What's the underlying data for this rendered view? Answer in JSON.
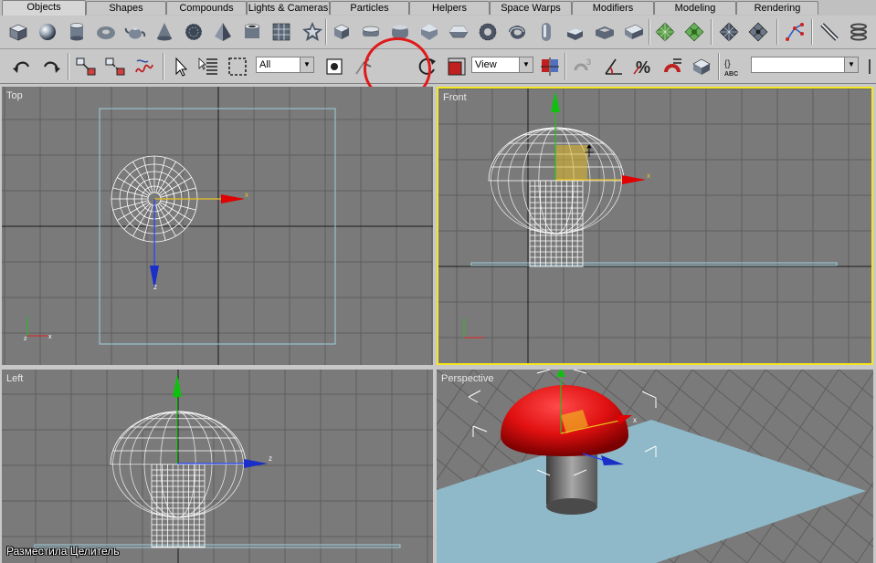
{
  "tabs": [
    {
      "label": "Objects",
      "active": true
    },
    {
      "label": "Shapes",
      "active": false
    },
    {
      "label": "Compounds",
      "active": false
    },
    {
      "label": "Lights & Cameras",
      "active": false
    },
    {
      "label": "Particles",
      "active": false
    },
    {
      "label": "Helpers",
      "active": false
    },
    {
      "label": "Space Warps",
      "active": false
    },
    {
      "label": "Modifiers",
      "active": false
    },
    {
      "label": "Modeling",
      "active": false
    },
    {
      "label": "Rendering",
      "active": false
    }
  ],
  "toolbar": {
    "selection_filter": "All",
    "reference_coordinate": "View",
    "named_selection": ""
  },
  "viewports": {
    "top": {
      "label": "Top"
    },
    "front": {
      "label": "Front"
    },
    "left": {
      "label": "Left"
    },
    "perspective": {
      "label": "Perspective"
    }
  },
  "axes": {
    "x": "x",
    "y": "y",
    "z": "z"
  },
  "colors": {
    "viewport_bg": "#7a7a7a",
    "grid": "#5e5e5e",
    "active_border": "#f5e61e",
    "move_tool_active": "#f5c542",
    "annotation_circle": "#e0191b",
    "mushroom_cap": "#e0191b",
    "ground_plane": "#8fb9c8"
  },
  "caption": "Разместила Целитель"
}
